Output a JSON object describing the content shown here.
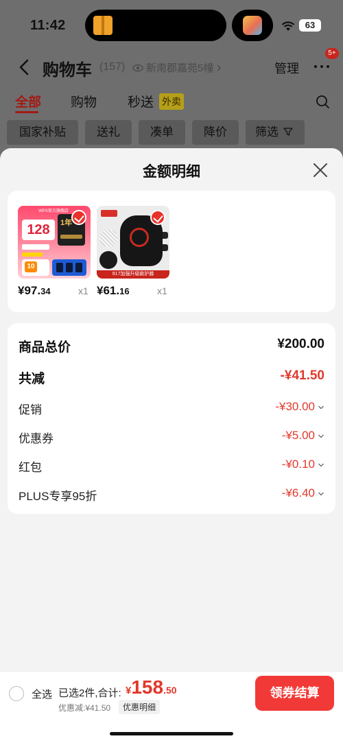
{
  "status_bar": {
    "time": "11:42",
    "battery": "63",
    "icons": [
      "package-icon",
      "app-icon",
      "wifi-icon",
      "battery-icon"
    ]
  },
  "header": {
    "title": "购物车",
    "count": "(157)",
    "address": "新南郡嘉苑5幢",
    "manage_label": "管理",
    "more_badge": "5+"
  },
  "tabs": [
    {
      "label": "全部",
      "active": true
    },
    {
      "label": "购物",
      "active": false
    },
    {
      "label": "秒送",
      "active": false,
      "tag": "外卖"
    }
  ],
  "filter_chips": [
    "国家补贴",
    "送礼",
    "凑单",
    "降价",
    "筛选"
  ],
  "sheet": {
    "title": "金额明细",
    "products": [
      {
        "price_yuan": "¥97.",
        "price_cents": "34",
        "qty": "x1",
        "selected": true,
        "image_text": {
          "banner": "WPS官方旗舰店",
          "number": "128",
          "card": "1年",
          "mini": "10"
        }
      },
      {
        "price_yuan": "¥61.",
        "price_cents": "16",
        "qty": "x1",
        "selected": true,
        "image_text": {
          "label": "917加强升级款护膝"
        }
      }
    ],
    "summary": [
      {
        "label": "商品总价",
        "value": "¥200.00",
        "style": "total"
      },
      {
        "label": "共减",
        "value": "-¥41.50",
        "style": "strong"
      },
      {
        "label": "促销",
        "value": "-¥30.00",
        "style": "normal"
      },
      {
        "label": "优惠券",
        "value": "-¥5.00",
        "style": "normal"
      },
      {
        "label": "红包",
        "value": "-¥0.10",
        "style": "normal"
      },
      {
        "label": "PLUS专享95折",
        "value": "-¥6.40",
        "style": "normal"
      }
    ]
  },
  "bottom_bar": {
    "select_all": "全选",
    "selected_text": "已选2件,合计:",
    "total_currency": "¥",
    "total_int": "158",
    "total_dec": ".50",
    "discount_text": "优惠减:¥41.50",
    "detail_link": "优惠明细",
    "checkout_label": "领券结算"
  },
  "colors": {
    "accent_red": "#e1382c",
    "checkout_red": "#f13a37",
    "sheet_bg": "#f3f3f3"
  }
}
